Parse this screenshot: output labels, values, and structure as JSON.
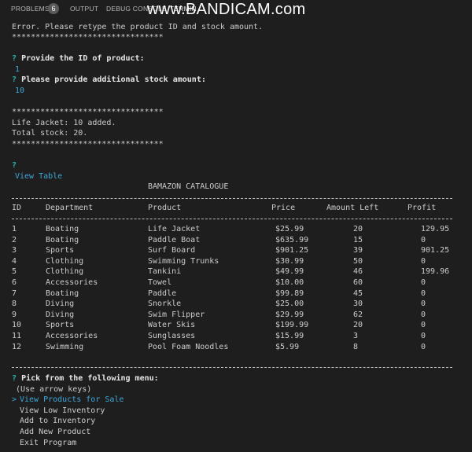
{
  "panel": {
    "tabs": {
      "problems": "PROBLEMS",
      "problems_count": "6",
      "output": "OUTPUT",
      "debug": "DEBUG CONSOLE",
      "terminal": "TERMIN"
    },
    "watermark": "www.BANDICAM.com"
  },
  "terminal": {
    "error_msg": "Error. Please retype the product ID and stock amount.",
    "stars": "********************************",
    "q_mark": "?",
    "prompt_id": "Provide the ID of product:",
    "answer_id": "1",
    "prompt_stock": "Please provide additional stock amount:",
    "answer_stock": "10",
    "added_msg": "Life Jacket: 10 added.",
    "total_msg": "Total stock: 20.",
    "view_table": "View Table",
    "catalogue_title": "BAMAZON CATALOGUE",
    "headers": {
      "id": "ID",
      "department": "Department",
      "product": "Product",
      "price": "Price",
      "amount": "Amount Left",
      "profit": "Profit"
    },
    "rows": [
      {
        "id": "1",
        "department": "Boating",
        "product": "Life Jacket",
        "price": "$25.99",
        "amount": "20",
        "profit": "129.95"
      },
      {
        "id": "2",
        "department": "Boating",
        "product": "Paddle Boat",
        "price": "$635.99",
        "amount": "15",
        "profit": "0"
      },
      {
        "id": "3",
        "department": "Sports",
        "product": "Surf Board",
        "price": "$901.25",
        "amount": "39",
        "profit": "901.25"
      },
      {
        "id": "4",
        "department": "Clothing",
        "product": "Swimming Trunks",
        "price": "$30.99",
        "amount": "50",
        "profit": "0"
      },
      {
        "id": "5",
        "department": "Clothing",
        "product": "Tankini",
        "price": "$49.99",
        "amount": "46",
        "profit": "199.96"
      },
      {
        "id": "6",
        "department": "Accessories",
        "product": "Towel",
        "price": "$10.00",
        "amount": "60",
        "profit": "0"
      },
      {
        "id": "7",
        "department": "Boating",
        "product": "Paddle",
        "price": "$99.89",
        "amount": "45",
        "profit": "0"
      },
      {
        "id": "8",
        "department": "Diving",
        "product": "Snorkle",
        "price": "$25.00",
        "amount": "30",
        "profit": "0"
      },
      {
        "id": "9",
        "department": "Diving",
        "product": "Swim Flipper",
        "price": "$29.99",
        "amount": "62",
        "profit": "0"
      },
      {
        "id": "10",
        "department": "Sports",
        "product": "Water Skis",
        "price": "$199.99",
        "amount": "20",
        "profit": "0"
      },
      {
        "id": "11",
        "department": "Accessories",
        "product": "Sunglasses",
        "price": "$15.99",
        "amount": "3",
        "profit": "0"
      },
      {
        "id": "12",
        "department": "Swimming",
        "product": "Pool Foam Noodles",
        "price": "$5.99",
        "amount": "8",
        "profit": "0"
      }
    ],
    "menu_prompt": "Pick from the following menu:",
    "menu_hint": "(Use arrow keys)",
    "menu_pointer": ">",
    "menu_items": [
      "View Products for Sale",
      "View Low Inventory",
      "Add to Inventory",
      "Add New Product",
      "Exit Program"
    ]
  },
  "colors": {
    "background": "#1e1e1e",
    "text": "#cccccc",
    "question": "#21b6a8",
    "selected": "#3ea8d8"
  }
}
